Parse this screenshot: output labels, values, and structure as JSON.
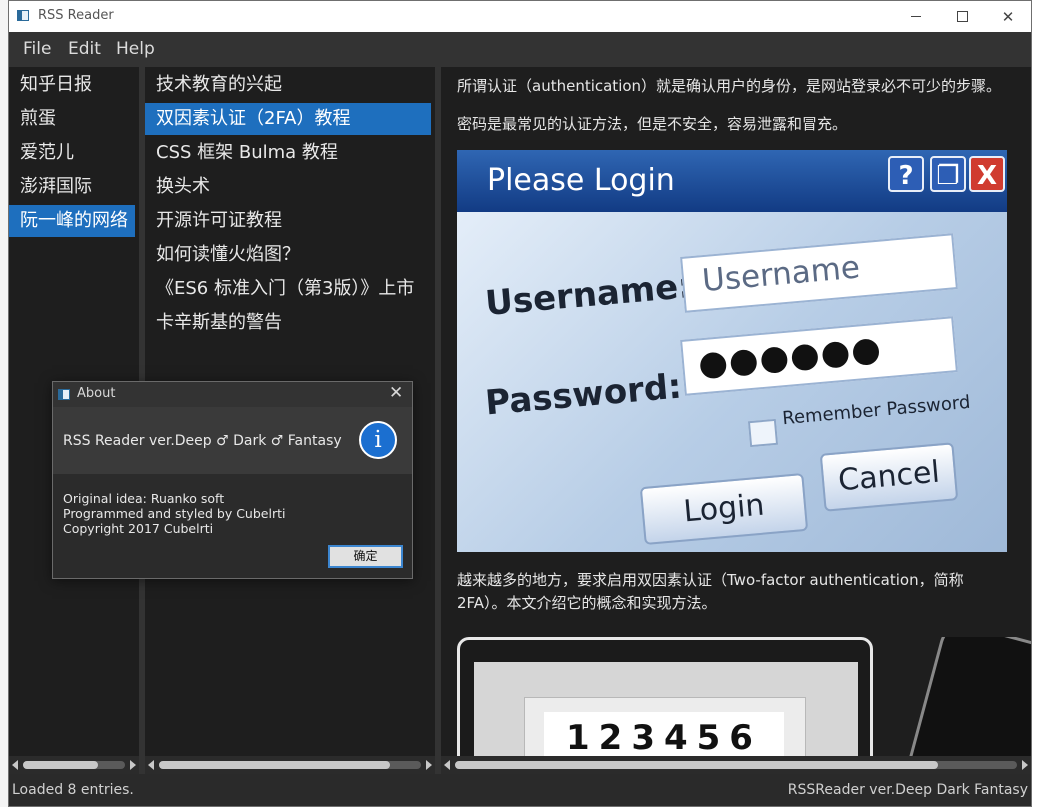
{
  "window": {
    "title": "RSS Reader"
  },
  "menu": {
    "file": "File",
    "edit": "Edit",
    "help": "Help"
  },
  "feeds": [
    {
      "label": "知乎日报",
      "selected": false
    },
    {
      "label": "煎蛋",
      "selected": false
    },
    {
      "label": "爱范儿",
      "selected": false
    },
    {
      "label": "澎湃国际",
      "selected": false
    },
    {
      "label": "阮一峰的网络",
      "selected": true
    }
  ],
  "articles": [
    {
      "label": "技术教育的兴起",
      "selected": false
    },
    {
      "label": "双因素认证（2FA）教程",
      "selected": true
    },
    {
      "label": "CSS 框架 Bulma 教程",
      "selected": false
    },
    {
      "label": "换头术",
      "selected": false
    },
    {
      "label": "开源许可证教程",
      "selected": false
    },
    {
      "label": "如何读懂火焰图？",
      "selected": false
    },
    {
      "label": "《ES6 标准入门（第3版）》上市",
      "selected": false
    },
    {
      "label": "卡辛斯基的警告",
      "selected": false
    }
  ],
  "content": {
    "p1": "所谓认证（authentication）就是确认用户的身份，是网站登录必不可少的步骤。",
    "p2": "密码是最常见的认证方法，但是不安全，容易泄露和冒充。",
    "login_image": {
      "title": "Please Login",
      "buttons": [
        "?",
        "❐",
        "X"
      ],
      "username_label": "Username:",
      "username_placeholder": "Username",
      "password_label": "Password:",
      "password_mask": "●●●●●●",
      "remember": "Remember Password",
      "login": "Login",
      "cancel": "Cancel"
    },
    "p3_line1": "越来越多的地方，要求启用双因素认证（Two-factor authentication，简称",
    "p3_line2": "2FA）。本文介绍它的概念和实现方法。",
    "twofa_image": {
      "code": "123456"
    }
  },
  "status": {
    "left": "Loaded 8 entries.",
    "right": "RSSReader ver.Deep Dark Fantasy"
  },
  "about": {
    "title": "About",
    "app": "RSS Reader ver.Deep ♂ Dark ♂ Fantasy",
    "info_icon": "i",
    "lines": [
      "Original idea: Ruanko soft",
      "Programmed and styled by Cubelrti",
      "Copyright 2017 Cubelrti"
    ],
    "ok": "确定"
  },
  "scrollbars": {
    "feeds": {
      "position": 0.0,
      "visible_fraction": 0.74
    },
    "articles": {
      "position": 0.0,
      "visible_fraction": 0.88
    },
    "content": {
      "position": 0.0,
      "visible_fraction": 0.86
    }
  }
}
